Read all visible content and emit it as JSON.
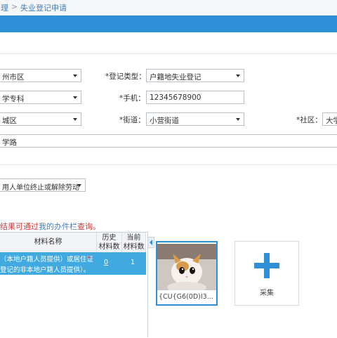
{
  "breadcrumb": {
    "prev": "理",
    "sep": ">",
    "current": "失业登记申请"
  },
  "form": {
    "row1": {
      "left_value": "州市区",
      "label": "*登记类型：",
      "value": "户籍地失业登记"
    },
    "row2": {
      "left_value": "学专科",
      "label": "*手机：",
      "value": "12345678900"
    },
    "row3": {
      "left_value": "城区",
      "street_label": "*街道：",
      "street_value": "小营街道",
      "community_label": "*社区：",
      "community_value": "大学"
    },
    "address": "学路",
    "reason": "用人单位终止或解除劳动"
  },
  "note": {
    "prefix": "结果可通过",
    "link": "我的办件栏",
    "suffix": "查询。"
  },
  "materials": {
    "headers": {
      "name": "材料名称",
      "history": "历史\n材料数",
      "current": "当前\n材料数"
    },
    "rows": [
      {
        "name_line1": "（本地户籍人员提供）或居住证",
        "name_line2": "登记的非本地户籍人员提供）。",
        "history": "0",
        "current": "1"
      }
    ]
  },
  "upload": {
    "thumb_caption": "{CU{G6(0D)I3...",
    "add_label": "采集"
  },
  "colors": {
    "accent": "#2e8fd6",
    "selected_row": "#3fa9e0",
    "required": "#e03a3a"
  }
}
